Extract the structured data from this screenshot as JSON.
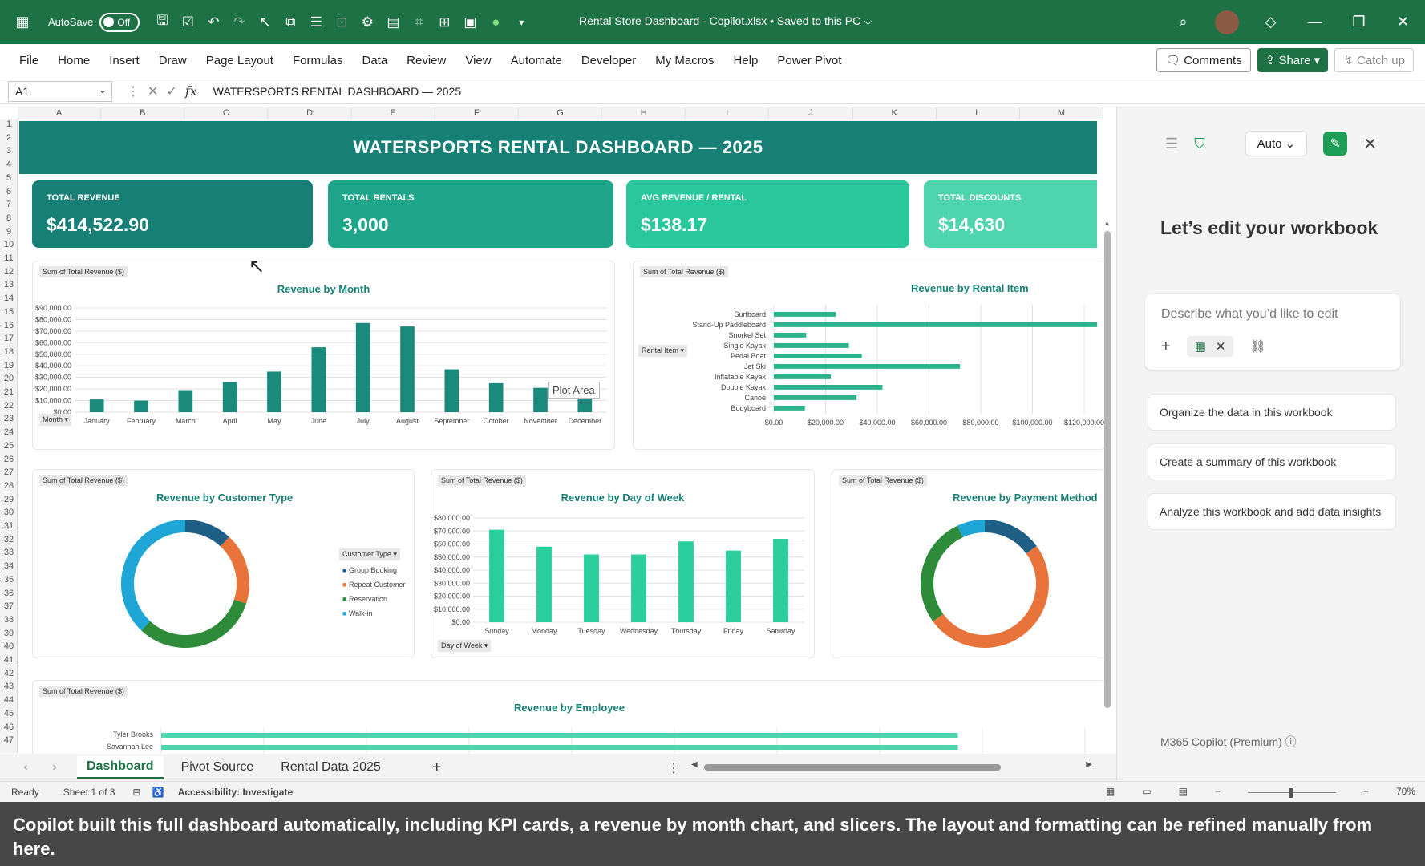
{
  "titlebar": {
    "autosave_label": "AutoSave",
    "autosave_state": "Off",
    "window_title": "Rental Store Dashboard - Copilot.xlsx • Saved to this PC ⌵"
  },
  "menu": {
    "items": [
      "File",
      "Home",
      "Insert",
      "Draw",
      "Page Layout",
      "Formulas",
      "Data",
      "Review",
      "View",
      "Automate",
      "Developer",
      "My Macros",
      "Help",
      "Power Pivot"
    ],
    "comments": "Comments",
    "share": "Share",
    "catchup": "Catch up"
  },
  "formula": {
    "cell": "A1",
    "fx": "fx",
    "content": "WATERSPORTS RENTAL DASHBOARD — 2025"
  },
  "columns": [
    "A",
    "B",
    "C",
    "D",
    "E",
    "F",
    "G",
    "H",
    "I",
    "J",
    "K",
    "L",
    "M"
  ],
  "rows": [
    "1",
    "2",
    "3",
    "4",
    "5",
    "6",
    "7",
    "8",
    "9",
    "10",
    "11",
    "12",
    "13",
    "14",
    "15",
    "16",
    "17",
    "18",
    "19",
    "20",
    "21",
    "22",
    "23",
    "24",
    "25",
    "26",
    "27",
    "28",
    "29",
    "30",
    "31",
    "32",
    "33",
    "34",
    "35",
    "36",
    "37",
    "38",
    "39",
    "40",
    "41",
    "42",
    "43",
    "44",
    "45",
    "46",
    "47"
  ],
  "dashboard": {
    "title": "WATERSPORTS RENTAL DASHBOARD — 2025",
    "kpis": [
      {
        "label": "TOTAL REVENUE",
        "value": "$414,522.90",
        "color": "#177f75"
      },
      {
        "label": "TOTAL RENTALS",
        "value": "3,000",
        "color": "#1fa68a"
      },
      {
        "label": "AVG REVENUE / RENTAL",
        "value": "$138.17",
        "color": "#2bc79c"
      },
      {
        "label": "TOTAL DISCOUNTS",
        "value": "$14,630",
        "color": "#4fd5ae"
      }
    ]
  },
  "chart_field_label": "Sum of Total Revenue ($)",
  "chart_data": [
    {
      "type": "bar",
      "title": "Revenue by Month",
      "slicer": "Month",
      "tooltip": "Plot Area",
      "categories": [
        "January",
        "February",
        "March",
        "April",
        "May",
        "June",
        "July",
        "August",
        "September",
        "October",
        "November",
        "December"
      ],
      "values": [
        11000,
        10000,
        19000,
        26000,
        35000,
        56000,
        77000,
        74000,
        37000,
        25000,
        21000,
        19000
      ],
      "ylim": [
        0,
        90000
      ],
      "yticks": [
        "$0.00",
        "$10,000.00",
        "$20,000.00",
        "$30,000.00",
        "$40,000.00",
        "$50,000.00",
        "$60,000.00",
        "$70,000.00",
        "$80,000.00",
        "$90,000.00"
      ],
      "color": "#1a8a7c"
    },
    {
      "type": "bar",
      "orientation": "horizontal",
      "title": "Revenue by Rental Item",
      "slicer": "Rental Item",
      "categories": [
        "Surfboard",
        "Stand-Up Paddleboard",
        "Snorkel Set",
        "Single Kayak",
        "Pedal Boat",
        "Jet Ski",
        "Inflatable Kayak",
        "Double Kayak",
        "Canoe",
        "Bodyboard"
      ],
      "values": [
        24000,
        125000,
        12500,
        29000,
        34000,
        72000,
        22000,
        42000,
        32000,
        12000
      ],
      "xlim": [
        0,
        125000
      ],
      "xticks": [
        "$0.00",
        "$20,000.00",
        "$40,000.00",
        "$60,000.00",
        "$80,000.00",
        "$100,000.00",
        "$120,000.00"
      ],
      "color": "#2bb38c"
    },
    {
      "type": "pie",
      "title": "Revenue by Customer Type",
      "slicer": "Customer Type",
      "categories": [
        "Group Booking",
        "Repeat Customer",
        "Reservation",
        "Walk-in"
      ],
      "values": [
        12,
        18,
        32,
        38
      ],
      "colors": [
        "#1f5f86",
        "#e8743b",
        "#2e8b3a",
        "#1fa6d6"
      ]
    },
    {
      "type": "bar",
      "title": "Revenue by Day of Week",
      "slicer": "Day of Week",
      "categories": [
        "Sunday",
        "Monday",
        "Tuesday",
        "Wednesday",
        "Thursday",
        "Friday",
        "Saturday"
      ],
      "values": [
        71000,
        58000,
        52000,
        52000,
        62000,
        55000,
        64000
      ],
      "ylim": [
        0,
        80000
      ],
      "yticks": [
        "$0.00",
        "$10,000.00",
        "$20,000.00",
        "$30,000.00",
        "$40,000.00",
        "$50,000.00",
        "$60,000.00",
        "$70,000.00",
        "$80,000.00"
      ],
      "color": "#2bcf9d"
    },
    {
      "type": "pie",
      "title": "Revenue by Payment Method",
      "values": [
        15,
        50,
        28,
        7
      ],
      "colors": [
        "#1f5f86",
        "#e8743b",
        "#2e8b3a",
        "#1fa6d6"
      ]
    },
    {
      "type": "bar",
      "orientation": "horizontal",
      "title": "Revenue by Employee",
      "categories": [
        "Tyler Brooks",
        "Savannah Lee"
      ],
      "values": [
        95,
        95
      ],
      "color": "#4fd5ae"
    }
  ],
  "sheets": {
    "tabs": [
      "Dashboard",
      "Pivot Source",
      "Rental Data 2025"
    ],
    "add": "+"
  },
  "copilot": {
    "mode": "Auto",
    "heading": "Let’s edit your workbook",
    "placeholder": "Describe what you’d like to edit",
    "suggestions": [
      "Organize the data in this workbook",
      "Create a summary of this workbook",
      "Analyze this workbook and add data insights"
    ],
    "footer": "M365 Copilot (Premium)"
  },
  "status": {
    "ready": "Ready",
    "sheet": "Sheet 1 of 3",
    "accessibility": "Accessibility: Investigate",
    "zoom": "70%"
  },
  "caption": "Copilot built this full dashboard automatically, including KPI cards, a revenue by month chart, and slicers. The layout and formatting can be refined manually from here."
}
